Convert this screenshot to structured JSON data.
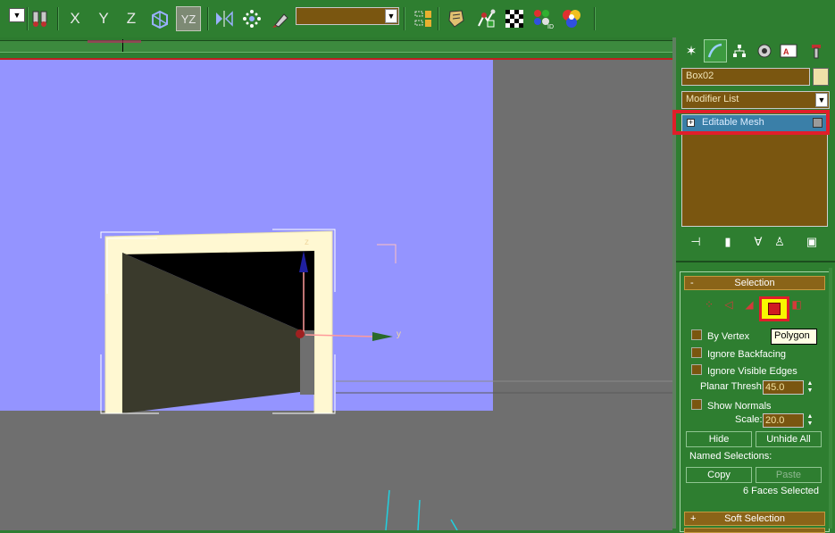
{
  "toolbar": {
    "axis_labels": [
      "X",
      "Y",
      "Z"
    ],
    "plane_constraint": "YZ",
    "named_selection_value": ""
  },
  "viewport": {
    "gizmo_axis_z": "z",
    "gizmo_axis_y": "y"
  },
  "command_panel": {
    "object_name": "Box02",
    "object_color": "#f0e0a8",
    "modifier_list_label": "Modifier List",
    "stack": [
      {
        "label": "Editable Mesh",
        "expand_sign": "+"
      }
    ],
    "selection_rollout": {
      "title": "Selection",
      "collapse_sign": "-",
      "subobject_levels": [
        "vertex",
        "edge",
        "face",
        "polygon",
        "element"
      ],
      "active_level": "polygon",
      "tooltip": "Polygon",
      "by_vertex_label": "By Vertex",
      "ignore_backfacing_label": "Ignore Backfacing",
      "ignore_visible_edges_label": "Ignore Visible Edges",
      "planar_thresh_label": "Planar Thresh:",
      "planar_thresh_value": "45.0",
      "show_normals_label": "Show Normals",
      "scale_label": "Scale:",
      "scale_value": "20.0",
      "hide_label": "Hide",
      "unhide_all_label": "Unhide All",
      "named_selections_label": "Named Selections:",
      "copy_label": "Copy",
      "paste_label": "Paste",
      "status_text": "6 Faces Selected"
    },
    "soft_selection": {
      "title": "Soft Selection",
      "expand_sign": "+"
    }
  },
  "colors": {
    "ui_green": "#2e7e30",
    "field_brown": "#7a5610",
    "highlight_red": "#e01e2a",
    "viewport_background": "#9494ff",
    "stack_selected": "#3a7fa8"
  }
}
